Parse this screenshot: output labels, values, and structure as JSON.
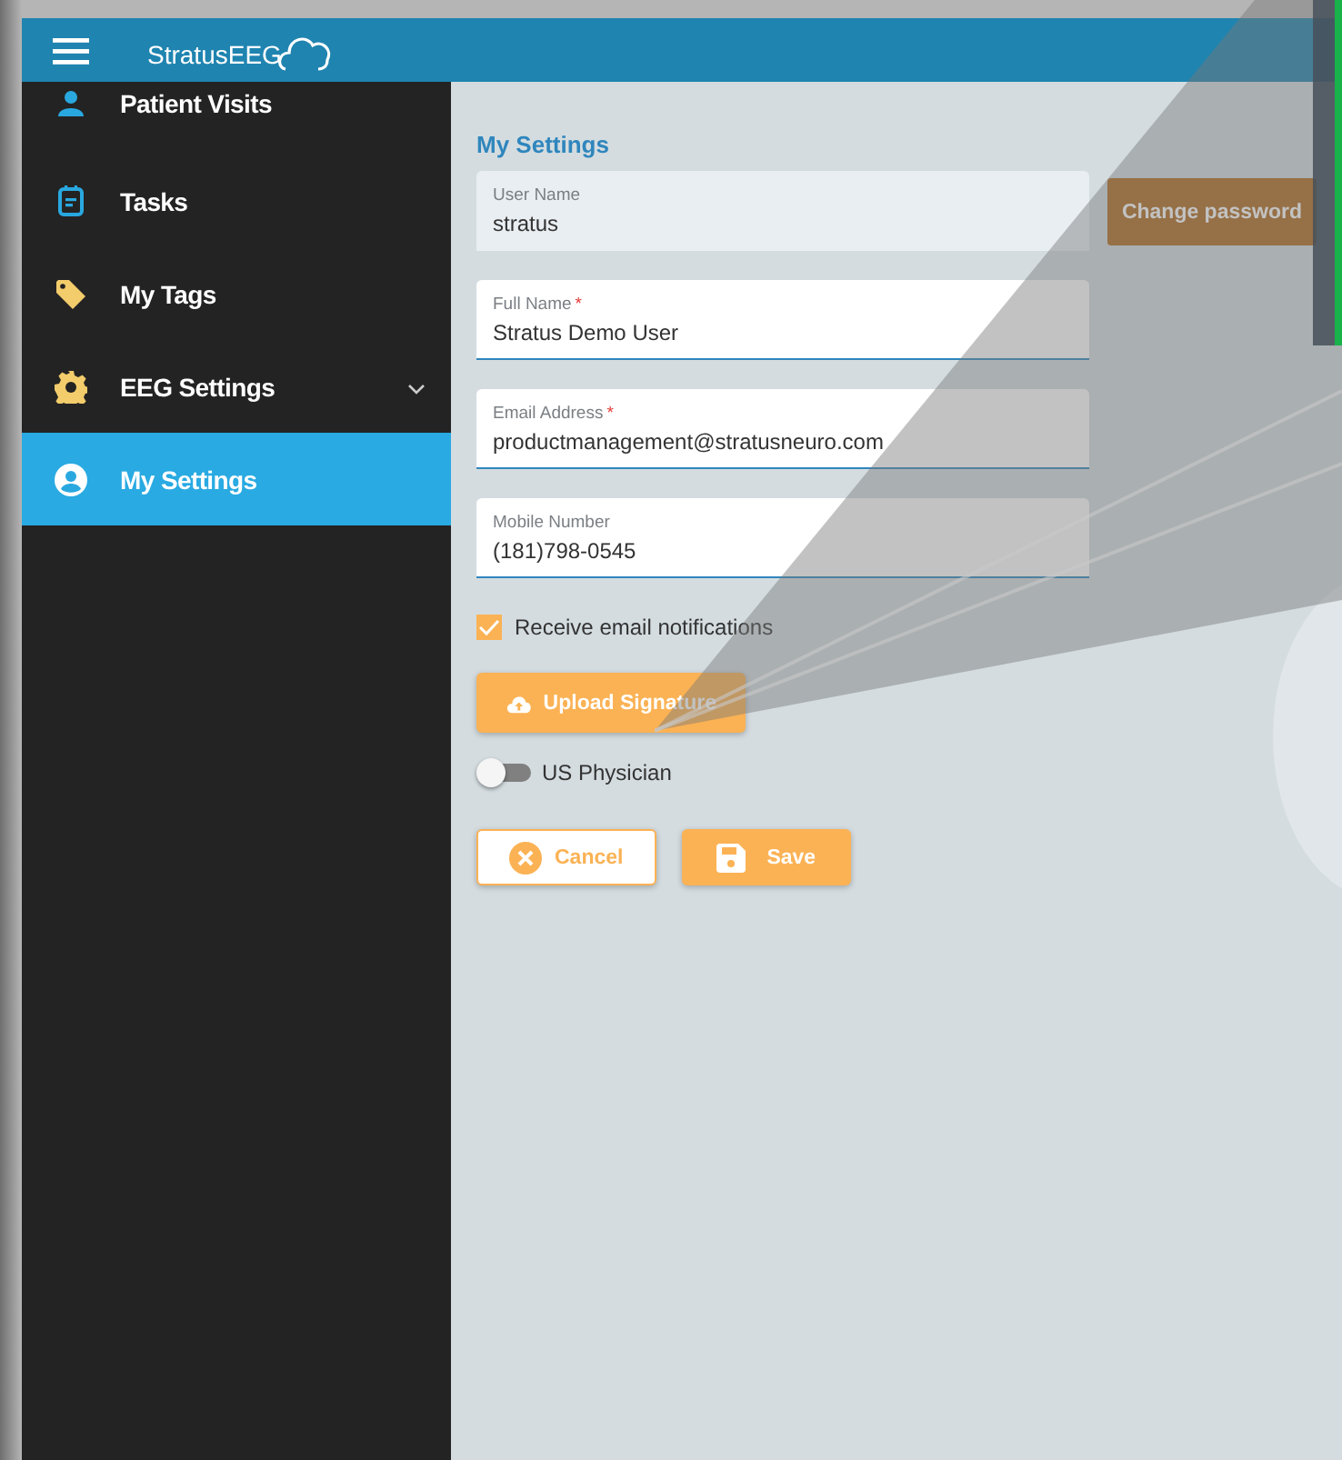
{
  "header": {
    "logo": "StratusEEG"
  },
  "sidebar": {
    "items": [
      {
        "label": "Patient Visits",
        "chevron": false,
        "selected": false
      },
      {
        "label": "Tasks",
        "chevron": false,
        "selected": false
      },
      {
        "label": "My Tags",
        "chevron": false,
        "selected": false
      },
      {
        "label": "EEG Settings",
        "chevron": true,
        "selected": false
      },
      {
        "label": "My Settings",
        "chevron": false,
        "selected": true
      }
    ]
  },
  "settings": {
    "title": "My Settings",
    "fields": [
      {
        "label": "User Name",
        "value": "stratus",
        "disabled": true
      },
      {
        "label": "Full Name",
        "required_mark": "*",
        "value": "Stratus Demo User",
        "disabled": false
      },
      {
        "label": "Email Address",
        "required_mark": "*",
        "value": "productmanagement@stratusneuro.com",
        "disabled": false
      },
      {
        "label": "Mobile Number",
        "value": "(181)798-0545",
        "disabled": false
      }
    ],
    "change_password": {
      "label": "Change password",
      "disabled": true
    },
    "notifications": {
      "label": "Receive email notifications",
      "checked": true
    },
    "upload": {
      "label": "Upload Signature"
    },
    "physician": {
      "label": "US Physician",
      "on": false
    },
    "buttons": [
      {
        "label": "Cancel",
        "kind": "cancel"
      },
      {
        "label": "Save",
        "kind": "save"
      }
    ]
  }
}
